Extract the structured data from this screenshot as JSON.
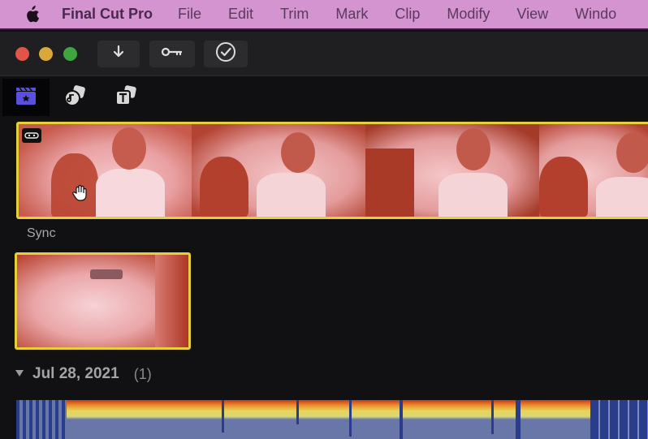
{
  "menubar": {
    "apple_icon": "apple-logo-icon",
    "app_name": "Final Cut Pro",
    "items": [
      "File",
      "Edit",
      "Trim",
      "Mark",
      "Clip",
      "Modify",
      "View",
      "Windo"
    ]
  },
  "toolbar": {
    "window_controls": [
      {
        "name": "close",
        "color": "#e0554a"
      },
      {
        "name": "minimize",
        "color": "#d9a83a"
      },
      {
        "name": "zoom",
        "color": "#3fa540"
      }
    ],
    "buttons": [
      {
        "name": "import-media",
        "icon": "down-arrow-icon"
      },
      {
        "name": "keywords",
        "icon": "key-icon"
      },
      {
        "name": "background-tasks",
        "icon": "checkmark-circle-icon"
      }
    ]
  },
  "browser_tabs": [
    {
      "name": "libraries",
      "icon": "clapper-icon",
      "active": true
    },
    {
      "name": "photos-and-audio",
      "icon": "photos-audio-icon",
      "active": false
    },
    {
      "name": "titles-and-generators",
      "icon": "titles-icon",
      "active": false
    }
  ],
  "clips": [
    {
      "label": "Sync",
      "badge_icon": "multicam-icon",
      "selected": true,
      "frames": 4
    },
    {
      "label": "",
      "selected": true,
      "frames": 1
    }
  ],
  "event_group": {
    "date": "Jul 28, 2021",
    "count": "(1)",
    "expanded": true
  },
  "colors": {
    "selection": "#e5cf3a",
    "menubar_bg": "#d394cf",
    "active_tab_icon": "#5b4fe0",
    "audio_wave": "#6876a8"
  }
}
